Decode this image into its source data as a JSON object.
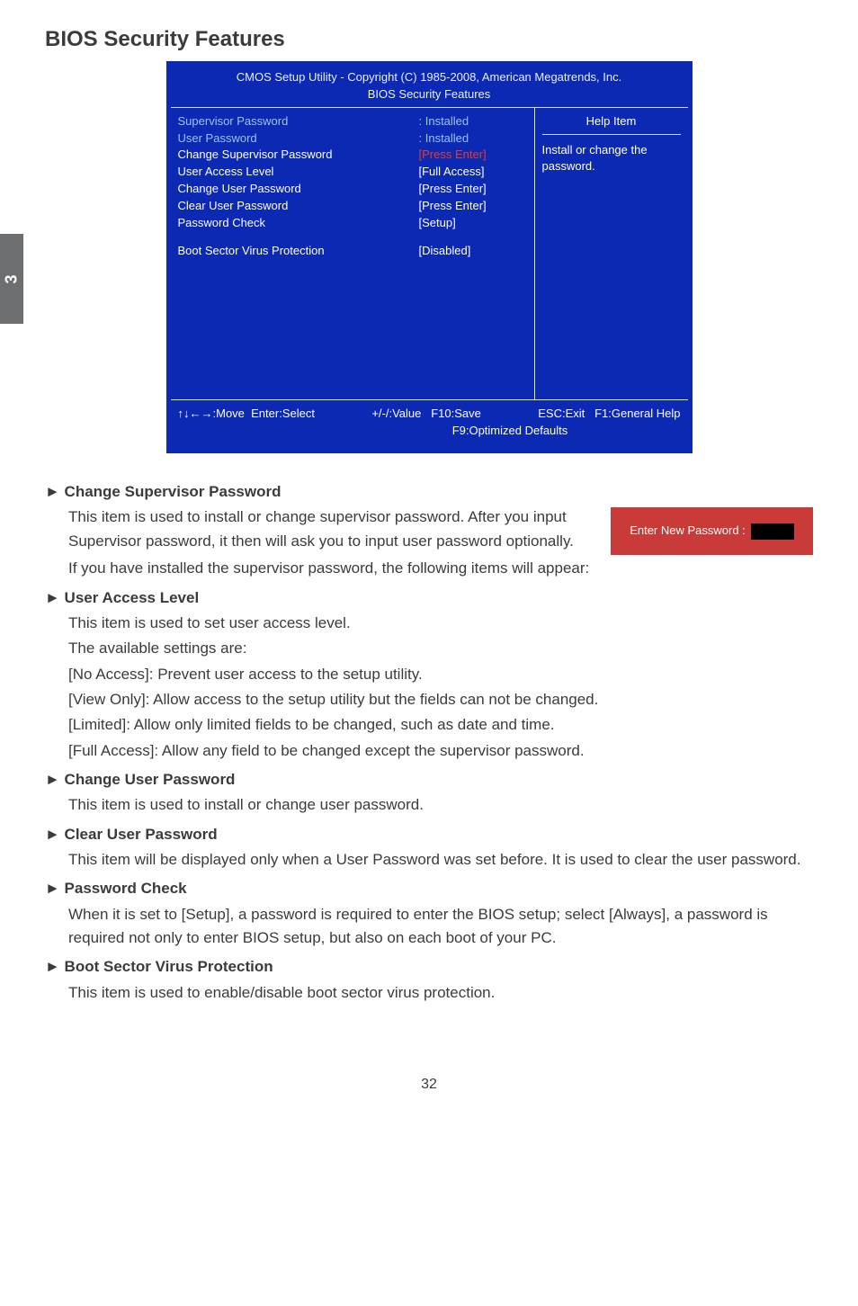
{
  "sidebar": {
    "chapter": "3"
  },
  "page": {
    "title": "BIOS Security Features",
    "number": "32"
  },
  "bios": {
    "header_line1": "CMOS Setup Utility - Copyright (C) 1985-2008, American Megatrends, Inc.",
    "header_line2": "BIOS Security Features",
    "help_title": "Help Item",
    "help_text": "Install or change the password.",
    "rows": {
      "sup_pw_label": "Supervisor Password",
      "sup_pw_val": ": Installed",
      "user_pw_label": "User Password",
      "user_pw_val": ": Installed",
      "change_sup_label": "Change Supervisor Password",
      "change_sup_val": "[Press Enter]",
      "access_label": "User Access Level",
      "access_val": "[Full Access]",
      "change_user_label": "Change User Password",
      "change_user_val": "[Press Enter]",
      "clear_user_label": "Clear User Password",
      "clear_user_val": "[Press Enter]",
      "pw_check_label": "Password Check",
      "pw_check_val": "[Setup]",
      "boot_label": "Boot Sector Virus Protection",
      "boot_val": "[Disabled]"
    },
    "footer": {
      "move": "↑↓←→:Move",
      "select": "Enter:Select",
      "value": "+/-/:Value",
      "save": "F10:Save",
      "exit": "ESC:Exit",
      "help": "F1:General Help",
      "defaults": "F9:Optimized Defaults"
    }
  },
  "popup": {
    "label": "Enter New Password :"
  },
  "sections": {
    "s1_title": "► Change Supervisor Password",
    "s1_p1": "This item is used to install or change supervisor password. After you input Supervisor password, it then will ask you to input user password optionally.",
    "s1_p2": "If you have installed the supervisor password, the following items will appear:",
    "s2_title": "► User Access Level",
    "s2_p1": "This item is used to set user access level.",
    "s2_p2": "The available settings are:",
    "s2_p3": "[No Access]: Prevent user access to the setup utility.",
    "s2_p4": "[View Only]: Allow access to the setup utility but the fields can not be changed.",
    "s2_p5": "[Limited]: Allow only limited fields to be changed, such as date and time.",
    "s2_p6": "[Full Access]: Allow any field to be changed except the supervisor password.",
    "s3_title": "► Change User Password",
    "s3_p1": "This item is used to install or change user password.",
    "s4_title": "► Clear User Password",
    "s4_p1": "This item will be displayed only when a User Password was set before. It is used to clear the user password.",
    "s5_title": "► Password Check",
    "s5_p1": "When it is set to [Setup], a password is required to enter the BIOS setup; select [Always], a password is required not only to enter BIOS setup, but also on each boot of your PC.",
    "s6_title": "► Boot Sector Virus Protection",
    "s6_p1": "This item is used to enable/disable boot sector virus protection."
  }
}
